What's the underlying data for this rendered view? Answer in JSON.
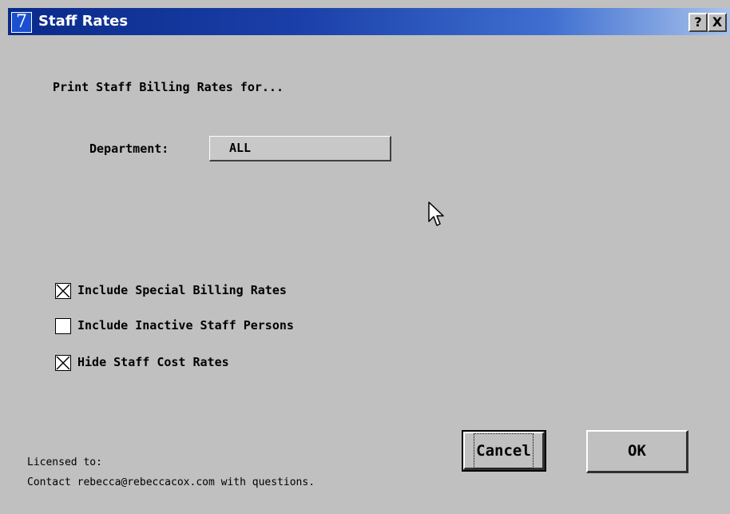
{
  "window": {
    "title": "Staff Rates",
    "app_icon_glyph": "7",
    "help_label": "?",
    "close_label": "X"
  },
  "dialog": {
    "heading": "Print Staff Billing Rates for...",
    "department_label": "Department:",
    "department_value": "ALL",
    "options": [
      {
        "label": "Include Special Billing Rates",
        "checked": true
      },
      {
        "label": "Include Inactive Staff Persons",
        "checked": false
      },
      {
        "label": "Hide Staff Cost Rates",
        "checked": true
      }
    ],
    "cancel_label": "Cancel",
    "ok_label": "OK",
    "license_line1": "Licensed to:",
    "license_line2": "Contact rebecca@rebeccacox.com with questions."
  },
  "colors": {
    "title_gradient_start": "#0a2a8a",
    "title_gradient_end": "#a8c2ec",
    "dialog_bg": "#c0c0c0"
  },
  "icons": [
    "app-icon",
    "help-icon",
    "close-icon",
    "checkbox-x-icon",
    "arrow-cursor-icon"
  ]
}
